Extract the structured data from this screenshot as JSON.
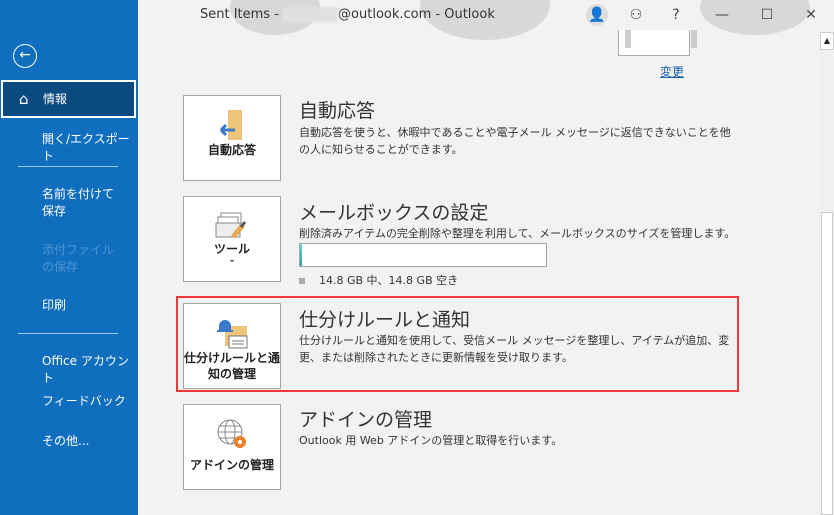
{
  "window": {
    "title_prefix": "Sent Items - ",
    "title_suffix": "@outlook.com  -  Outlook",
    "minimize": "—",
    "maximize": "☐",
    "close": "✕",
    "help": "?"
  },
  "sidebar": {
    "back_icon": "←",
    "items": [
      {
        "label": "情報",
        "selected": true
      },
      {
        "label": "開く/エクスポート"
      },
      {
        "label": "名前を付けて保存"
      },
      {
        "label": "添付ファイルの保存",
        "disabled": true
      },
      {
        "label": "印刷"
      },
      {
        "label": "Office アカウント"
      },
      {
        "label": "フィードバック"
      },
      {
        "label": "その他..."
      }
    ]
  },
  "profile": {
    "change_link": "変更"
  },
  "sections": [
    {
      "button": "自動応答",
      "title": "自動応答",
      "desc": "自動応答を使うと、休暇中であることや電子メール メッセージに返信できないことを他の人に知らせることができます。"
    },
    {
      "button": "ツール",
      "title": "メールボックスの設定",
      "desc": "削除済みアイテムの完全削除や整理を利用して、メールボックスのサイズを管理します。",
      "quota_text": "14.8 GB 中、14.8 GB 空き",
      "used_fraction": 0.01
    },
    {
      "button": "仕分けルールと通知の管理",
      "title": "仕分けルールと通知",
      "desc": "仕分けルールと通知を使用して、受信メール メッセージを整理し、アイテムが追加、変更、または削除されたときに更新情報を受け取ります。",
      "highlighted": true
    },
    {
      "button": "アドインの管理",
      "title": "アドインの管理",
      "desc": "Outlook 用 Web アドインの管理と取得を行います。"
    }
  ],
  "colors": {
    "sidebar": "#106ebe",
    "highlight": "#ee3a3a",
    "link": "#1a5fa8"
  }
}
